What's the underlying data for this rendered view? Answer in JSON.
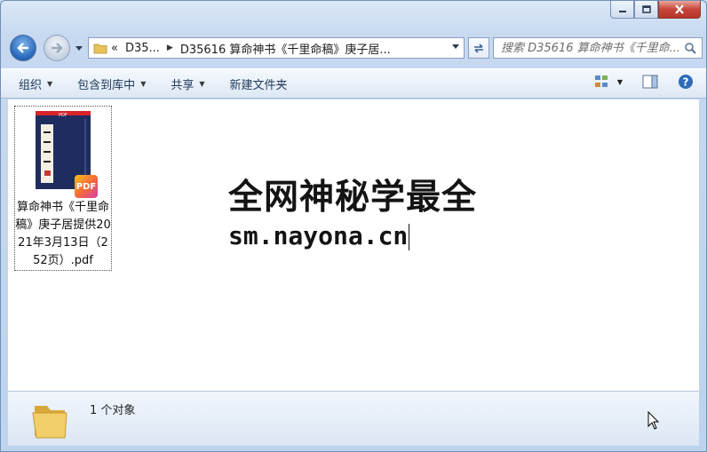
{
  "window": {
    "caption_buttons": [
      "minimize",
      "maximize",
      "close"
    ]
  },
  "nav": {
    "address": {
      "overflow": "«",
      "crumbs": [
        "D35...",
        "D35616 算命神书《千里命稿》庚子居..."
      ]
    },
    "search": {
      "placeholder": "搜索 D35616 算命神书《千里命..."
    }
  },
  "toolbar": {
    "organize": "组织",
    "include_library": "包含到库中",
    "share": "共享",
    "new_folder": "新建文件夹"
  },
  "content": {
    "files": [
      {
        "label": "算命神书《千里命稿》庚子居提供2021年3月13日（252页）.pdf",
        "type": "PDF"
      }
    ],
    "watermark": {
      "line1": "全网神秘学最全",
      "line2": "sm.nayona.cn"
    }
  },
  "status": {
    "count_text": "1 个对象"
  },
  "colors": {
    "chrome": "#c6d9f0",
    "close": "#c6453a",
    "book_cover": "#1f2d5e",
    "accent_red": "#d8232a"
  }
}
